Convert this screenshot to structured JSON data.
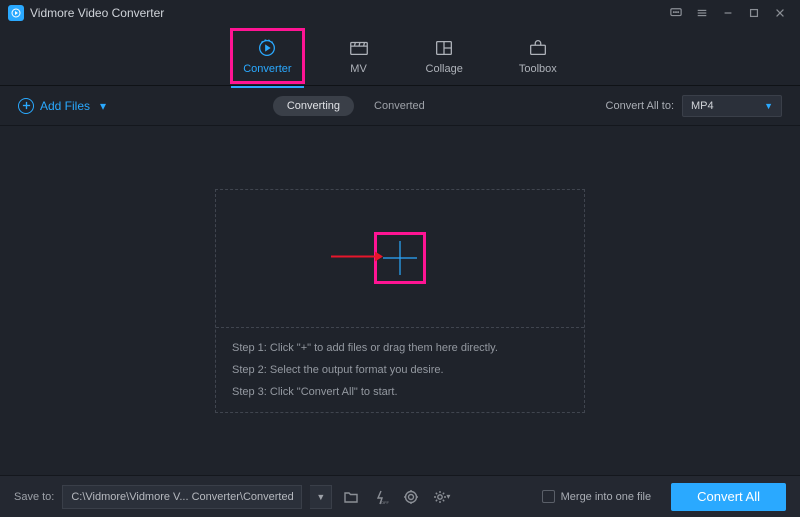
{
  "app": {
    "title": "Vidmore Video Converter"
  },
  "tabs": {
    "converter": "Converter",
    "mv": "MV",
    "collage": "Collage",
    "toolbox": "Toolbox"
  },
  "toolbar": {
    "add_files": "Add Files",
    "converting": "Converting",
    "converted": "Converted",
    "convert_all_to": "Convert All to:",
    "format": "MP4"
  },
  "dropzone": {
    "step1": "Step 1: Click \"+\" to add files or drag them here directly.",
    "step2": "Step 2: Select the output format you desire.",
    "step3": "Step 3: Click \"Convert All\" to start."
  },
  "footer": {
    "save_to": "Save to:",
    "path": "C:\\Vidmore\\Vidmore V... Converter\\Converted",
    "merge": "Merge into one file",
    "convert_all": "Convert All"
  }
}
